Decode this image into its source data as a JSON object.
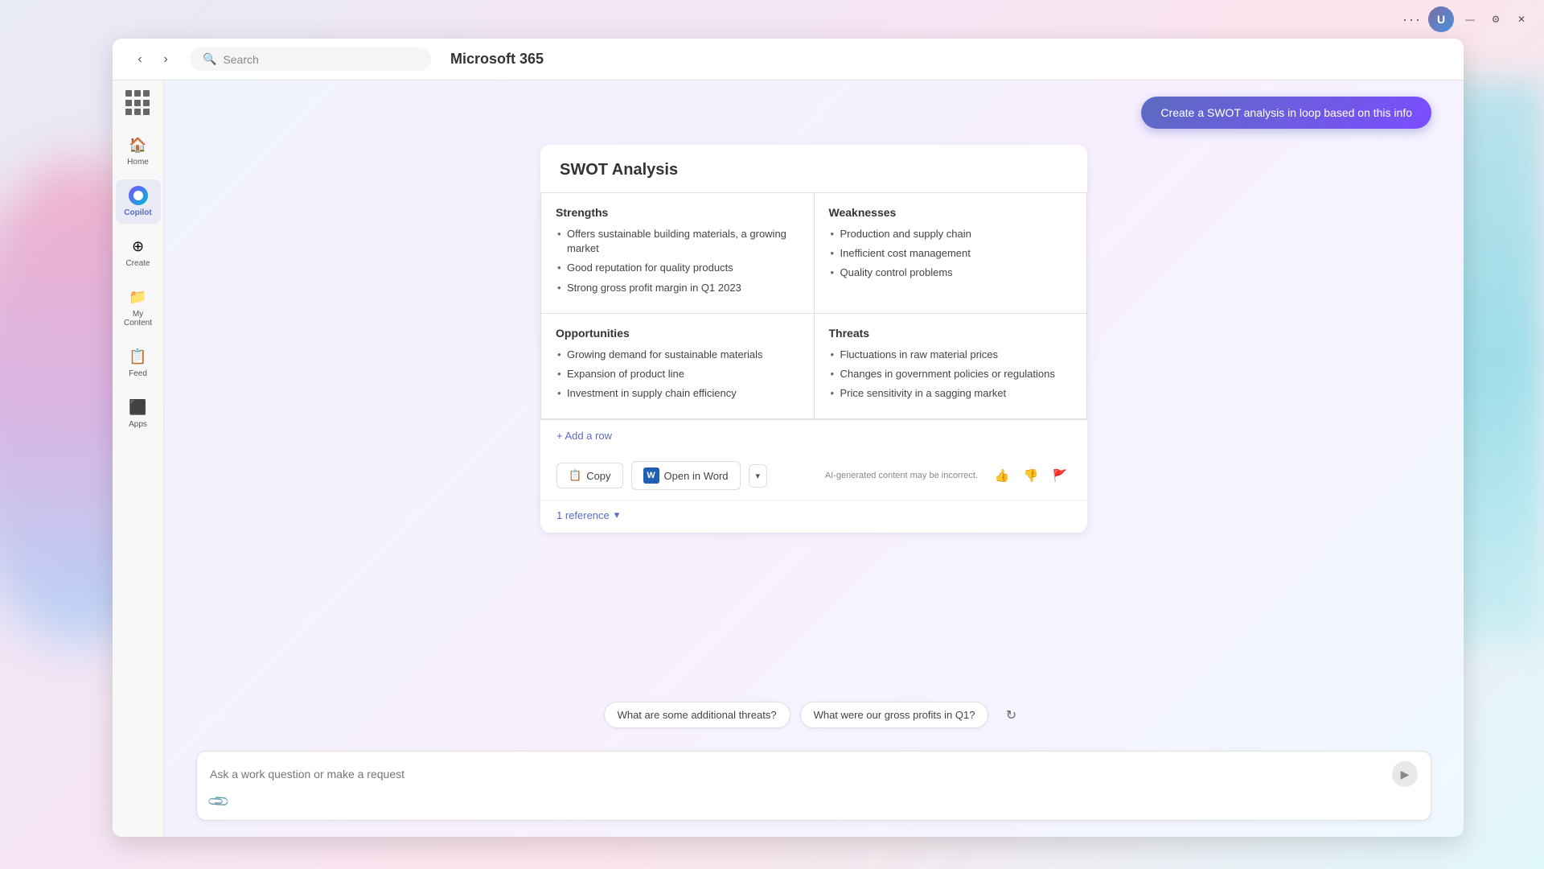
{
  "app": {
    "title": "Microsoft 365",
    "search_placeholder": "Search"
  },
  "titlebar": {
    "dots": "···",
    "minimize": "—",
    "settings": "⚙",
    "close": "✕"
  },
  "sidebar": {
    "items": [
      {
        "id": "home",
        "label": "Home",
        "icon": "🏠"
      },
      {
        "id": "copilot",
        "label": "Copilot",
        "icon": "copilot",
        "active": true
      },
      {
        "id": "create",
        "label": "Create",
        "icon": "➕"
      },
      {
        "id": "my-content",
        "label": "My Content",
        "icon": "📁"
      },
      {
        "id": "feed",
        "label": "Feed",
        "icon": "📋"
      },
      {
        "id": "apps",
        "label": "Apps",
        "icon": "🔲"
      }
    ]
  },
  "create_swot_button": "Create a SWOT analysis in loop based on this info",
  "swot": {
    "title": "SWOT Analysis",
    "strengths": {
      "label": "Strengths",
      "items": [
        "Offers sustainable building materials, a growing market",
        "Good reputation for quality products",
        "Strong gross profit margin in Q1 2023"
      ]
    },
    "weaknesses": {
      "label": "Weaknesses",
      "items": [
        "Production and supply chain",
        "Inefficient cost management",
        "Quality control problems"
      ]
    },
    "opportunities": {
      "label": "Opportunities",
      "items": [
        "Growing demand for sustainable materials",
        "Expansion of product line",
        "Investment in supply chain efficiency"
      ]
    },
    "threats": {
      "label": "Threats",
      "items": [
        "Fluctuations in raw material prices",
        "Changes in government policies or regulations",
        "Price sensitivity in a sagging market"
      ]
    },
    "add_row": "+ Add a row"
  },
  "actions": {
    "copy": "Copy",
    "open_in_word": "Open in Word",
    "dropdown_arrow": "▾",
    "ai_notice": "AI-generated content may be incorrect.",
    "thumbs_up": "👍",
    "thumbs_down": "👎",
    "flag": "🚩"
  },
  "reference": {
    "label": "1 reference",
    "chevron": "▾"
  },
  "suggestions": [
    "What are some additional threats?",
    "What were our gross profits in Q1?"
  ],
  "refresh_icon": "↻",
  "input": {
    "placeholder": "Ask a work question or make a request",
    "attach_icon": "🔗"
  }
}
